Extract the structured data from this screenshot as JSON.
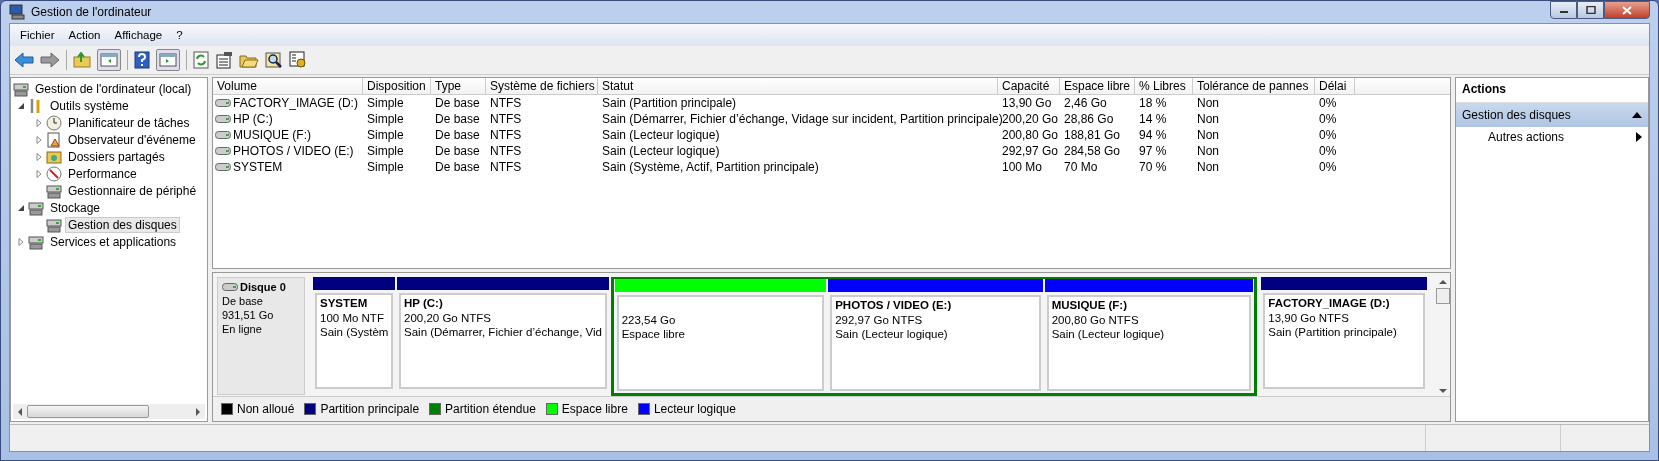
{
  "window": {
    "title": "Gestion de l'ordinateur"
  },
  "menu": [
    "Fichier",
    "Action",
    "Affichage",
    "?"
  ],
  "tree": [
    {
      "label": "Gestion de l'ordinateur (local)",
      "selected": false,
      "children": [
        {
          "label": "Outils système",
          "selected": false,
          "expanded": true,
          "children": [
            {
              "label": "Planificateur de tâches",
              "selected": false,
              "expanded": false
            },
            {
              "label": "Observateur d'événeme",
              "selected": false,
              "expanded": false
            },
            {
              "label": "Dossiers partagés",
              "selected": false,
              "expanded": false
            },
            {
              "label": "Performance",
              "selected": false,
              "expanded": false
            },
            {
              "label": "Gestionnaire de périphé",
              "selected": false
            }
          ]
        },
        {
          "label": "Stockage",
          "selected": false,
          "expanded": true,
          "children": [
            {
              "label": "Gestion des disques",
              "selected": true
            }
          ]
        },
        {
          "label": "Services et applications",
          "selected": false,
          "expanded": false
        }
      ]
    }
  ],
  "table": {
    "columns": [
      "Volume",
      "Disposition",
      "Type",
      "Système de fichiers",
      "Statut",
      "Capacité",
      "Espace libre",
      "% Libres",
      "Tolérance de pannes",
      "Délai"
    ],
    "rows": [
      [
        "FACTORY_IMAGE (D:)",
        "Simple",
        "De base",
        "NTFS",
        "Sain (Partition principale)",
        "13,90 Go",
        "2,46 Go",
        "18 %",
        "Non",
        "0%"
      ],
      [
        "HP (C:)",
        "Simple",
        "De base",
        "NTFS",
        "Sain (Démarrer, Fichier d’échange, Vidage sur incident, Partition principale)",
        "200,20 Go",
        "28,86 Go",
        "14 %",
        "Non",
        "0%"
      ],
      [
        "MUSIQUE (F:)",
        "Simple",
        "De base",
        "NTFS",
        "Sain (Lecteur logique)",
        "200,80 Go",
        "188,81 Go",
        "94 %",
        "Non",
        "0%"
      ],
      [
        "PHOTOS / VIDEO (E:)",
        "Simple",
        "De base",
        "NTFS",
        "Sain (Lecteur logique)",
        "292,97 Go",
        "284,58 Go",
        "97 %",
        "Non",
        "0%"
      ],
      [
        "SYSTEM",
        "Simple",
        "De base",
        "NTFS",
        "Sain (Système, Actif, Partition principale)",
        "100 Mo",
        "70 Mo",
        "70 %",
        "Non",
        "0%"
      ]
    ]
  },
  "disk": {
    "name": "Disque 0",
    "type": "De base",
    "size": "931,51 Go",
    "status": "En ligne",
    "partitions": [
      {
        "kind": "primary",
        "extended": false,
        "name": "SYSTEM",
        "size": "100 Mo NTF",
        "status": "Sain (Systèm"
      },
      {
        "kind": "primary",
        "extended": false,
        "name": "HP  (C:)",
        "size": "200,20 Go NTFS",
        "status": "Sain (Démarrer, Fichier d’échange, Vid"
      },
      {
        "kind": "free",
        "extended": true,
        "size": "223,54 Go",
        "status": "Espace libre"
      },
      {
        "kind": "logical",
        "extended": true,
        "name": "PHOTOS / VIDEO  (E:)",
        "size": "292,97 Go NTFS",
        "status": "Sain (Lecteur logique)"
      },
      {
        "kind": "logical",
        "extended": true,
        "name": "MUSIQUE  (F:)",
        "size": "200,80 Go NTFS",
        "status": "Sain (Lecteur logique)"
      },
      {
        "kind": "primary",
        "extended": false,
        "name": "FACTORY_IMAGE  (D:)",
        "size": "13,90 Go NTFS",
        "status": "Sain (Partition principale)"
      }
    ]
  },
  "legend": [
    {
      "label": "Non alloué",
      "color": "#000000"
    },
    {
      "label": "Partition principale",
      "color": "#000080"
    },
    {
      "label": "Partition étendue",
      "color": "#008000"
    },
    {
      "label": "Espace libre",
      "color": "#00ff00"
    },
    {
      "label": "Lecteur logique",
      "color": "#0000ff"
    }
  ],
  "actions": {
    "title": "Actions",
    "section": {
      "label": "Gestion des disques",
      "expanded": true
    },
    "items": [
      "Autres actions"
    ]
  }
}
